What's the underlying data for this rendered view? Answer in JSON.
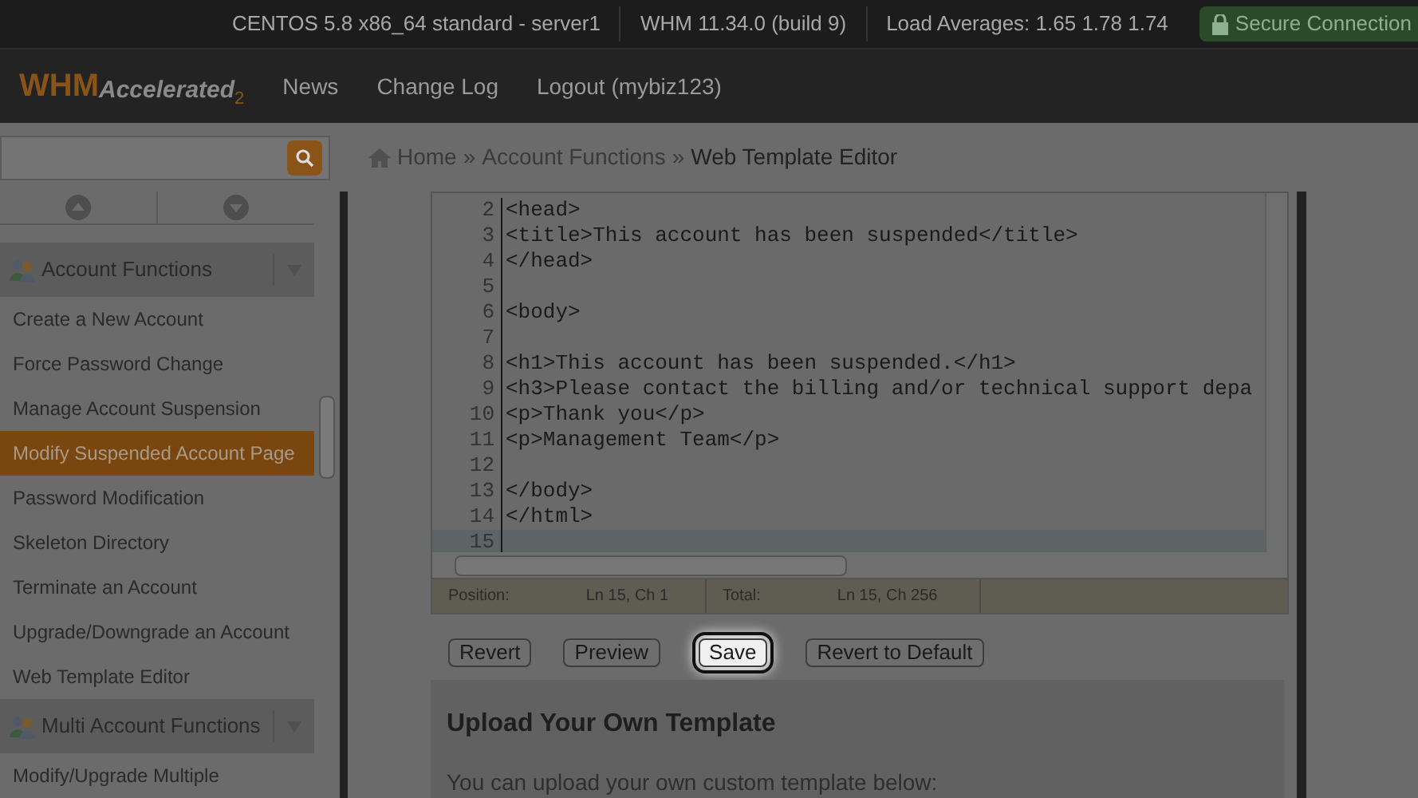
{
  "top_bar": {
    "server": "CENTOS 5.8 x86_64 standard - server1",
    "version": "WHM 11.34.0 (build 9)",
    "load": "Load Averages: 1.65 1.78 1.74",
    "secure": "Secure Connection"
  },
  "header": {
    "logo": "WHM",
    "logo_sub": "Accelerated",
    "logo_num": "2",
    "nav": [
      "News",
      "Change Log",
      "Logout (mybiz123)"
    ]
  },
  "breadcrumb": {
    "items": [
      "Home",
      "Account Functions",
      "Web Template Editor"
    ],
    "separator": "»"
  },
  "sidebar": {
    "groups": [
      {
        "title": "Account Functions",
        "items": [
          {
            "label": "Create a New Account",
            "selected": false
          },
          {
            "label": "Force Password Change",
            "selected": false
          },
          {
            "label": "Manage Account Suspension",
            "selected": false
          },
          {
            "label": "Modify Suspended Account Page",
            "selected": true
          },
          {
            "label": "Password Modification",
            "selected": false
          },
          {
            "label": "Skeleton Directory",
            "selected": false
          },
          {
            "label": "Terminate an Account",
            "selected": false
          },
          {
            "label": "Upgrade/Downgrade an Account",
            "selected": false
          },
          {
            "label": "Web Template Editor",
            "selected": false
          }
        ]
      },
      {
        "title": "Multi Account Functions",
        "items": [
          {
            "label": "Modify/Upgrade Multiple",
            "selected": false
          }
        ]
      }
    ]
  },
  "editor": {
    "lines": [
      {
        "number": "2",
        "code": "<head>",
        "current": false
      },
      {
        "number": "3",
        "code": "<title>This account has been suspended</title>",
        "current": false
      },
      {
        "number": "4",
        "code": "</head>",
        "current": false
      },
      {
        "number": "5",
        "current": false
      },
      {
        "number": "6",
        "code": "<body>",
        "current": false
      },
      {
        "number": "7",
        "current": false
      },
      {
        "number": "8",
        "code": "<h1>This account has been suspended.</h1>",
        "current": false
      },
      {
        "number": "9",
        "code": "<h3>Please contact the billing and/or technical support depa",
        "current": false
      },
      {
        "number": "10",
        "code": "<p>Thank you</p>",
        "current": false
      },
      {
        "number": "11",
        "code": "<p>Management Team</p>",
        "current": false
      },
      {
        "number": "12",
        "current": false
      },
      {
        "number": "13",
        "code": "</body>",
        "current": false
      },
      {
        "number": "14",
        "code": "</html>",
        "current": false
      },
      {
        "number": "15",
        "current": true
      }
    ],
    "status": [
      {
        "label": "Position:",
        "value": "Ln 15, Ch 1"
      },
      {
        "label": "Total:",
        "value": "Ln 15, Ch 256"
      }
    ]
  },
  "buttons": [
    {
      "label": "Revert",
      "highlighted": false
    },
    {
      "label": "Preview",
      "highlighted": false
    },
    {
      "label": "Save",
      "highlighted": true
    },
    {
      "label": "Revert to Default",
      "highlighted": false
    }
  ],
  "upload": {
    "title": "Upload Your Own Template",
    "text": "You can upload your own custom template below:"
  }
}
